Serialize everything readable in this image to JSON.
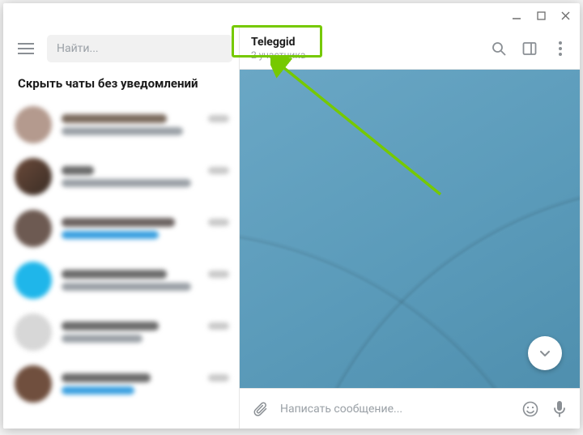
{
  "window": {
    "minimize": "—",
    "maximize": "□",
    "close": "✕"
  },
  "sidebar": {
    "search_placeholder": "Найти...",
    "section_label": "Скрыть чаты без уведомлений"
  },
  "chat": {
    "title": "Teleggid",
    "status": "2 участника",
    "input_placeholder": "Написать сообщение..."
  },
  "colors": {
    "accent": "#76c900",
    "muted": "#9aa0a6",
    "bg_chat": "#5b9bba"
  },
  "chats_blurred": [
    {
      "avatar": "#b49a8e",
      "name_w": 130,
      "name_c": "#7a6a5d",
      "sub_w": 150,
      "sub_c": "#9aa0a6"
    },
    {
      "avatar": "linear-gradient(135deg,#6b4a3a,#3a2d25)",
      "name_w": 40,
      "name_c": "#6b6b6b",
      "sub_w": 160,
      "sub_c": "#9aa0a6"
    },
    {
      "avatar": "#6d5a52",
      "name_w": 140,
      "name_c": "#6b6260",
      "sub_w": 120,
      "sub_c": "#3aa0e0"
    },
    {
      "avatar": "#1fb6ea",
      "name_w": 130,
      "name_c": "#6b6b6b",
      "sub_w": 160,
      "sub_c": "#9aa0a6"
    },
    {
      "avatar": "#d7d7d7",
      "name_w": 120,
      "name_c": "#6b6b6b",
      "sub_w": 100,
      "sub_c": "#9aa0a6"
    },
    {
      "avatar": "#704f3e",
      "name_w": 110,
      "name_c": "#6b6b6b",
      "sub_w": 90,
      "sub_c": "#3aa0e0"
    }
  ]
}
